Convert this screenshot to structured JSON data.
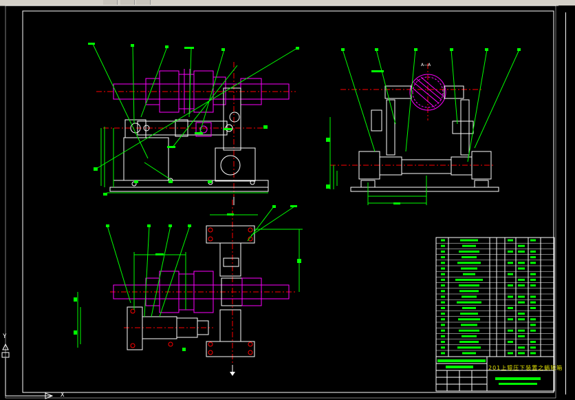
{
  "app": {
    "title_block_text": "201上辊压下装置之蜗轮箱",
    "ucs_x_label": "X",
    "ucs_y_label": "Y",
    "section_label": "A—A"
  },
  "colors": {
    "background": "#000000",
    "border": "#ffffff",
    "leader": "#00ff00",
    "part": "#ff00ff",
    "center": "#ff0000",
    "outline": "#ffffff",
    "title_text": "#e0e000"
  }
}
